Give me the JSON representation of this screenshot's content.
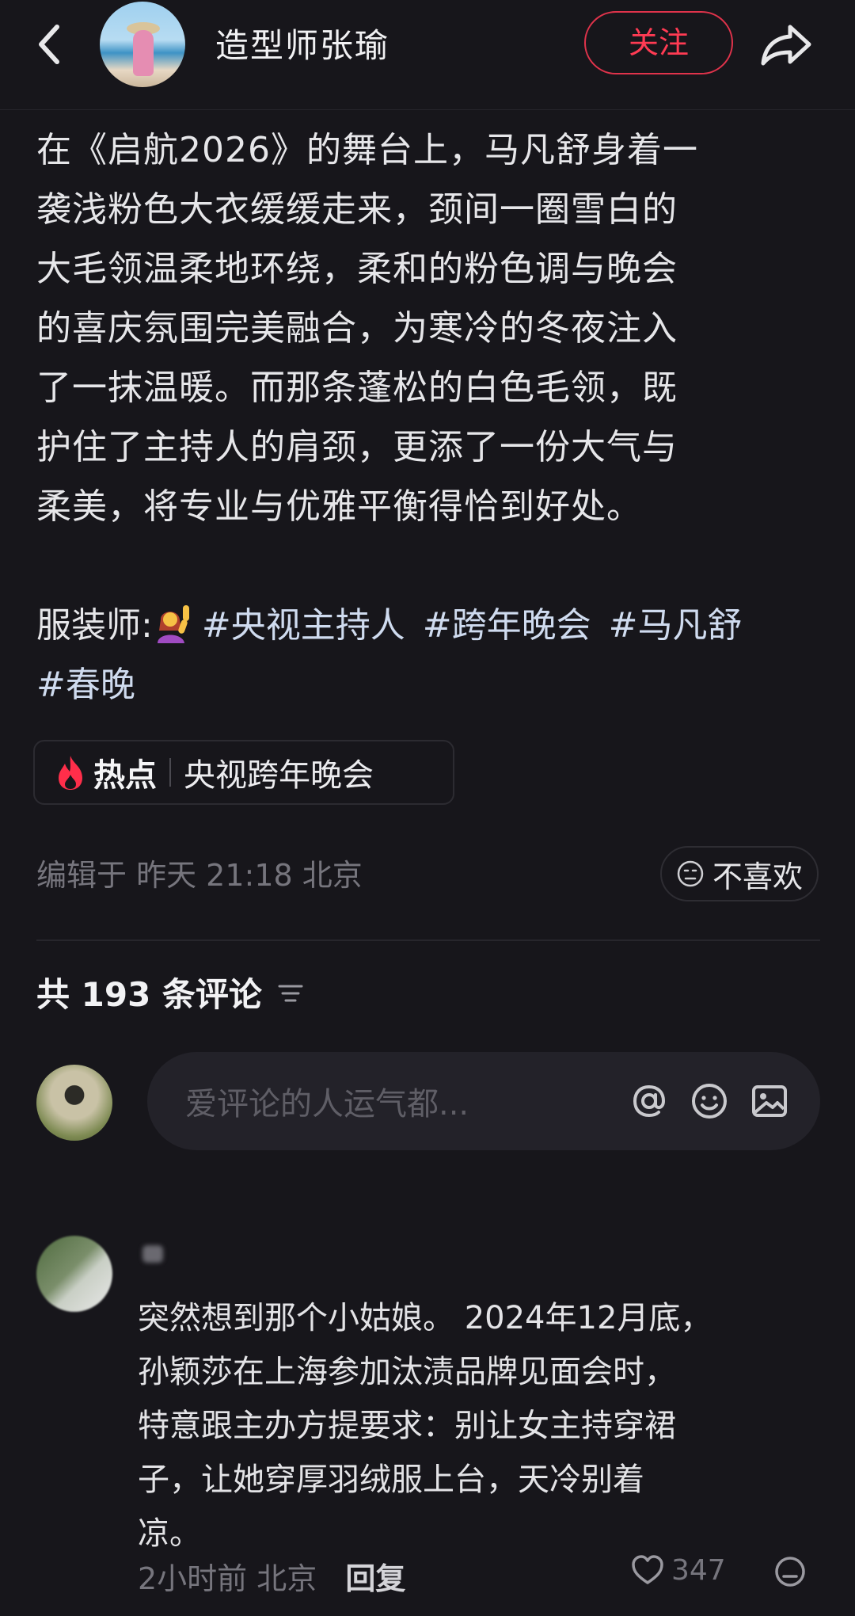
{
  "header": {
    "account_name": "造型师张瑜",
    "follow_label": "关注"
  },
  "article": {
    "lines": [
      "在《启航2026》的舞台上，马凡舒身着一",
      "袭浅粉色大衣缓缓走来，颈间一圈雪白的",
      "大毛领温柔地环绕，柔和的粉色调与晚会",
      "的喜庆氛围完美融合，为寒冷的冬夜注入",
      "了一抹温暖。而那条蓬松的白色毛领，既",
      "护住了主持人的肩颈，更添了一份大气与",
      "柔美，将专业与优雅平衡得恰到好处。"
    ],
    "stylist_prefix": "服装师:",
    "tags": [
      "#央视主持人",
      "#跨年晚会",
      "#马凡舒",
      "#春晚"
    ]
  },
  "hot": {
    "label": "热点",
    "topic": "央视跨年晚会"
  },
  "meta": {
    "edited": "编辑于  昨天 21:18 北京",
    "dislike_label": "不喜欢"
  },
  "comments": {
    "header": "共 193 条评论",
    "input_placeholder": "爱评论的人运气都...",
    "items": [
      {
        "lines": [
          "突然想到那个小姑娘。 2024年12月底，",
          "孙颖莎在上海参加汰渍品牌见面会时，",
          "特意跟主办方提要求：别让女主持穿裙",
          "子，让她穿厚羽绒服上台，天冷别着",
          "凉。"
        ],
        "time_location": "2小时前 北京",
        "reply_label": "回复",
        "likes": "347"
      }
    ]
  },
  "colors": {
    "background": "#17161b",
    "accent_red": "#ff3b53",
    "tag_blue": "#cfdbef",
    "muted": "#76757d"
  }
}
